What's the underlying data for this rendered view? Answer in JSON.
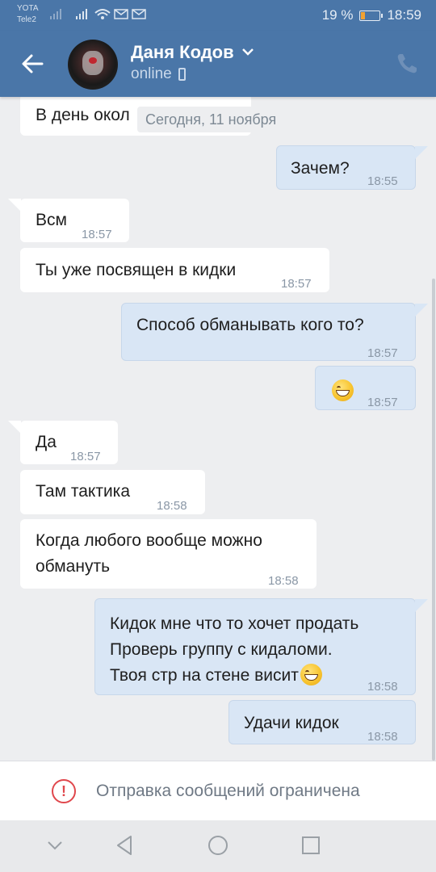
{
  "status_bar": {
    "carrier1": "YOTA",
    "carrier2": "Tele2",
    "battery": "19 %",
    "battery_level": 0.19,
    "time": "18:59"
  },
  "header": {
    "title": "Даня Кодов",
    "subtitle": "online",
    "icons": [
      "back-arrow-icon",
      "chevron-down-icon",
      "mobile-icon",
      "phone-icon"
    ]
  },
  "chat": {
    "date_separator": "Сегодня, 11 ноября",
    "messages": [
      {
        "dir": "in",
        "text": "В день окол",
        "time": ""
      },
      {
        "dir": "out",
        "text": "Зачем?",
        "time": "18:55"
      },
      {
        "dir": "in",
        "text": "Всм",
        "time": "18:57"
      },
      {
        "dir": "in",
        "text": "Ты уже посвящен в кидки",
        "time": "18:57"
      },
      {
        "dir": "out",
        "text": "Способ обманывать кого то?",
        "time": "18:57"
      },
      {
        "dir": "out",
        "text": "",
        "emoji": "grinning-face",
        "time": "18:57"
      },
      {
        "dir": "in",
        "text": "Да",
        "time": "18:57"
      },
      {
        "dir": "in",
        "text": "Там тактика",
        "time": "18:58"
      },
      {
        "dir": "in",
        "lines": [
          "Когда любого вообще можно",
          "обмануть"
        ],
        "time": "18:58"
      },
      {
        "dir": "out",
        "lines": [
          "Кидок мне что то хочет продать",
          "Проверь группу с кидаломи.",
          "Твоя стр на стене висит"
        ],
        "emoji": "grinning-face",
        "time": "18:58"
      },
      {
        "dir": "out",
        "text": "Удачи кидок",
        "time": "18:58"
      }
    ]
  },
  "footer": {
    "restriction_text": "Отправка сообщений ограничена",
    "icon": "exclamation-circle-icon"
  },
  "colors": {
    "header_bg": "#4a76a8",
    "outgoing_bubble": "#d9e6f5",
    "incoming_bubble": "#ffffff",
    "warning": "#e0474c"
  }
}
